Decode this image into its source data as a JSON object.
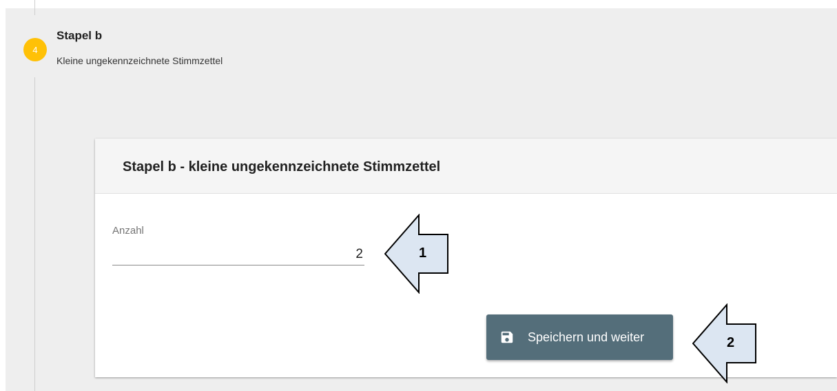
{
  "step": {
    "number": "4",
    "title": "Stapel b",
    "subtitle": "Kleine ungekennzeichnete Stimmzettel"
  },
  "card": {
    "title": "Stapel b - kleine ungekennzeichnete Stimmzettel",
    "field": {
      "label": "Anzahl",
      "value": "2"
    },
    "save_button": {
      "label": "Speichern und weiter",
      "icon": "floppy-disk-icon"
    }
  },
  "callouts": [
    "1",
    "2"
  ],
  "colors": {
    "panel_bg": "#eeeeee",
    "step_badge": "#ffc107",
    "button_bg": "#546e7a",
    "callout_fill": "#dce6f2"
  }
}
